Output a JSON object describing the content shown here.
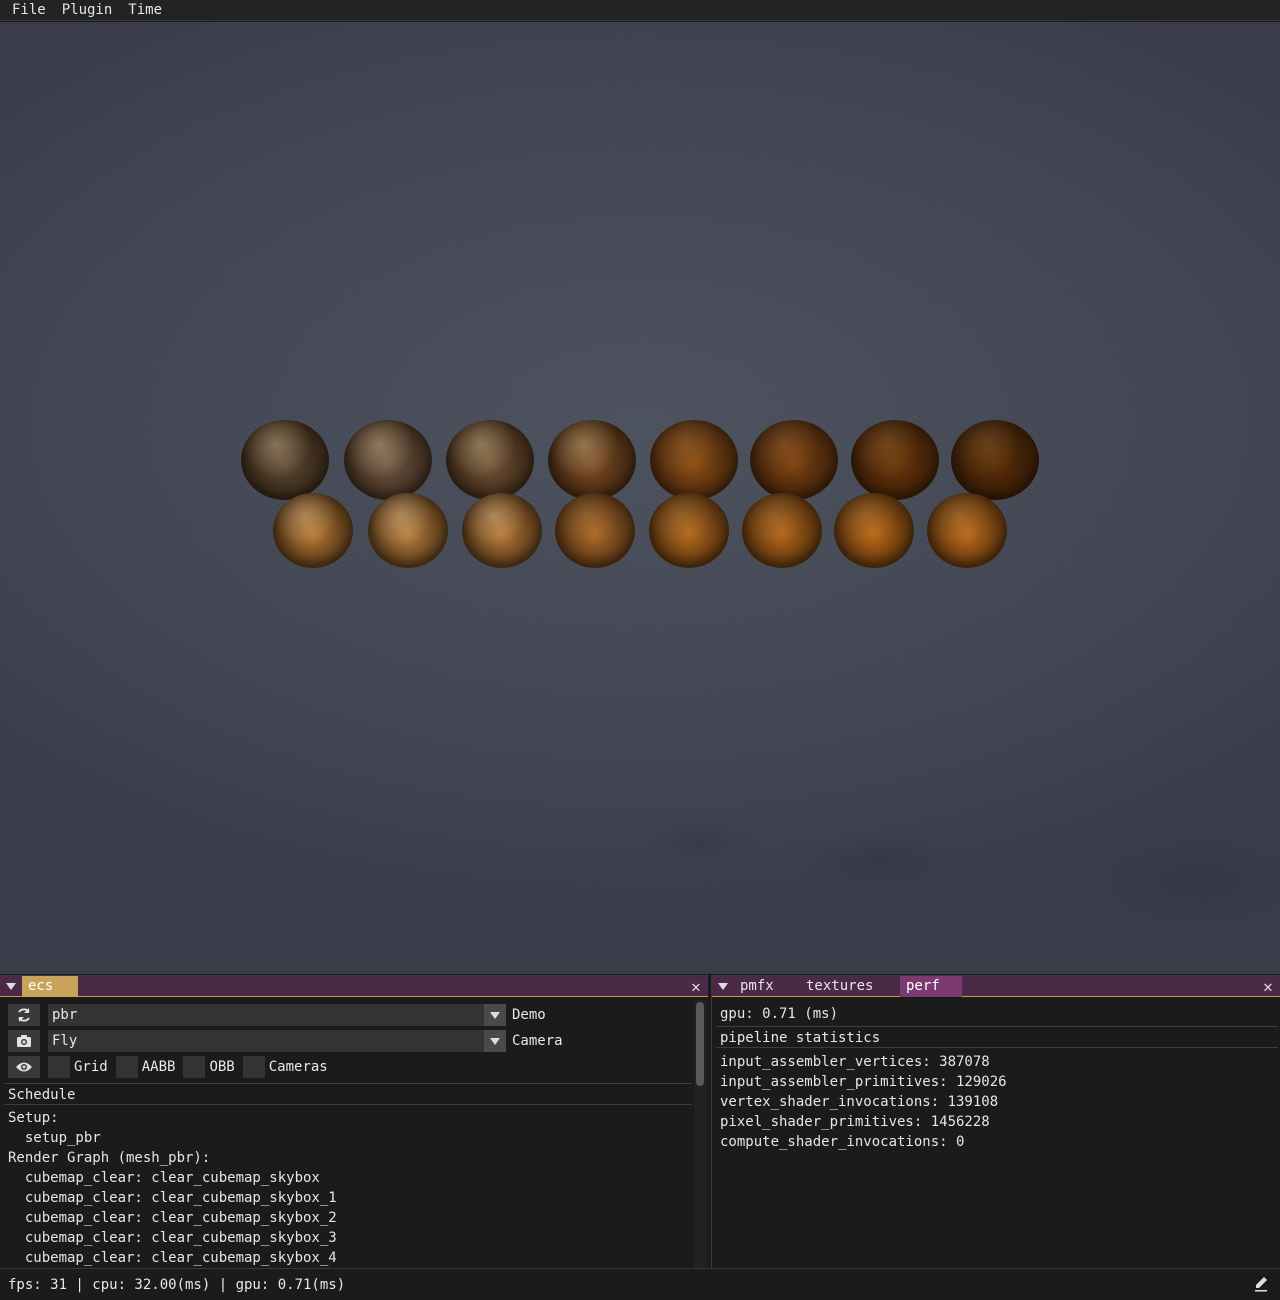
{
  "menubar": {
    "items": [
      "File",
      "Plugin",
      "Time"
    ]
  },
  "viewport": {
    "sphere_colors": {
      "top": [
        "#5a4632",
        "#6c5440",
        "#6e5034",
        "#7a4a22",
        "#8a4a12",
        "#7a3e0e",
        "#6a3408",
        "#5a2c06"
      ],
      "bottom": [
        "#b07430",
        "#b47a3a",
        "#b07434",
        "#a86628",
        "#b0661c",
        "#b06418",
        "#b86616",
        "#b86818"
      ]
    }
  },
  "ecs_panel": {
    "tab_label": "ecs",
    "demo_combo": {
      "value": "pbr",
      "label": "Demo"
    },
    "camera_combo": {
      "value": "Fly",
      "label": "Camera"
    },
    "debug_checks": [
      "Grid",
      "AABB",
      "OBB",
      "Cameras"
    ],
    "schedule_header": "Schedule",
    "lines": [
      "Setup:",
      "  setup_pbr",
      "Render Graph (mesh_pbr):",
      "  cubemap_clear: clear_cubemap_skybox",
      "  cubemap_clear: clear_cubemap_skybox_1",
      "  cubemap_clear: clear_cubemap_skybox_2",
      "  cubemap_clear: clear_cubemap_skybox_3",
      "  cubemap_clear: clear_cubemap_skybox_4"
    ]
  },
  "perf_panel": {
    "tabs": [
      "pmfx",
      "textures",
      "perf"
    ],
    "gpu_line": "gpu: 0.71 (ms)",
    "stats_header": "pipeline statistics",
    "stats": [
      "input_assembler_vertices: 387078",
      "input_assembler_primitives: 129026",
      "vertex_shader_invocations: 139108",
      "pixel_shader_primitives: 1456228",
      "compute_shader_invocations: 0"
    ]
  },
  "statusbar": {
    "text": "fps: 31 | cpu: 32.00(ms) | gpu: 0.71(ms)"
  },
  "colors": {
    "tab_bar": "#4b2a48",
    "tab_ecs_active": "#c7a45a",
    "tab_perf_active": "#7b3b72"
  }
}
